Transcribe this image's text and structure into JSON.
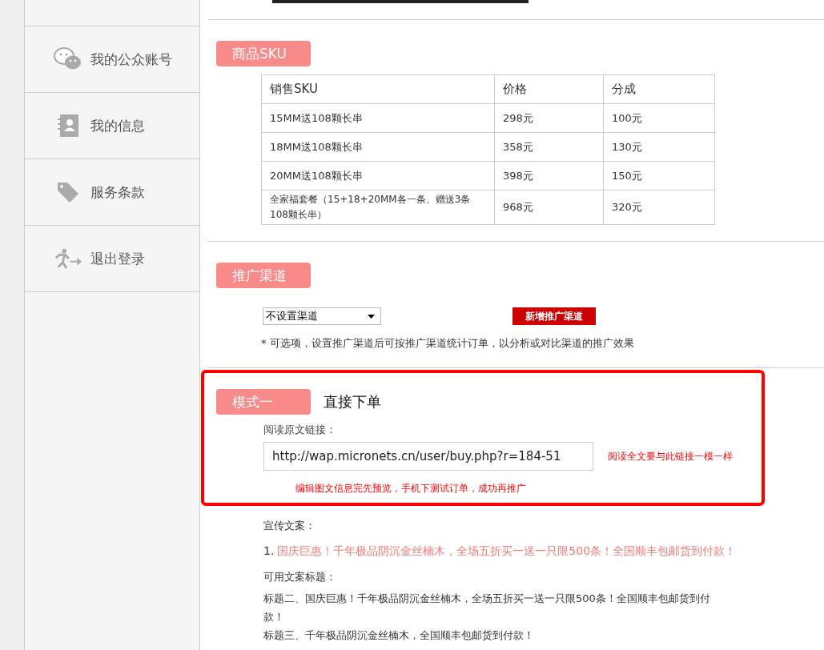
{
  "sidebar": {
    "items": [
      {
        "kind": "chat",
        "label": "我的公众账号"
      },
      {
        "kind": "contacts",
        "label": "我的信息"
      },
      {
        "kind": "tag",
        "label": "服务条款"
      },
      {
        "kind": "logout",
        "label": "退出登录"
      }
    ]
  },
  "sku_section": {
    "heading": "商品SKU",
    "table": {
      "columns": [
        "销售SKU",
        "价格",
        "分成"
      ],
      "rows": [
        [
          "15MM送108颗长串",
          "298元",
          "100元"
        ],
        [
          "18MM送108颗长串",
          "358元",
          "130元"
        ],
        [
          "20MM送108颗长串",
          "398元",
          "150元"
        ],
        [
          "全家福套餐（15+18+20MM各一条、赠送3条108颗长串）",
          "968元",
          "320元"
        ]
      ]
    }
  },
  "channel_section": {
    "heading": "推广渠道",
    "select_value": "不设置渠道",
    "add_button": "新增推广渠道",
    "note": "* 可选项，设置推广渠道后可按推广渠道统计订单，以分析或对比渠道的推广效果"
  },
  "mode_section": {
    "heading": "模式一",
    "title": "直接下单",
    "link_label": "阅读原文链接：",
    "link_value": "http://wap.micronets.cn/user/buy.php?r=184-51",
    "link_hint": "阅读全文要与此链接一模一样",
    "preview_hint": "编辑图文信息完先预览，手机下测试订单，成功再推广"
  },
  "copy_section": {
    "label": "宣传文案：",
    "items": [
      {
        "number": "1.",
        "text": "国庆巨惠！千年极品阴沉金丝楠木，全场五折买一送一只限500条！全国顺丰包邮货到付款！"
      }
    ],
    "titles_label": "可用文案标题：",
    "titles": [
      "标题二、国庆巨惠！千年极品阴沉金丝楠木，全场五折买一送一只限500条！全国顺丰包邮货到付款！",
      "标题三、千年极品阴沉金丝楠木，全国顺丰包邮货到付款！"
    ]
  }
}
